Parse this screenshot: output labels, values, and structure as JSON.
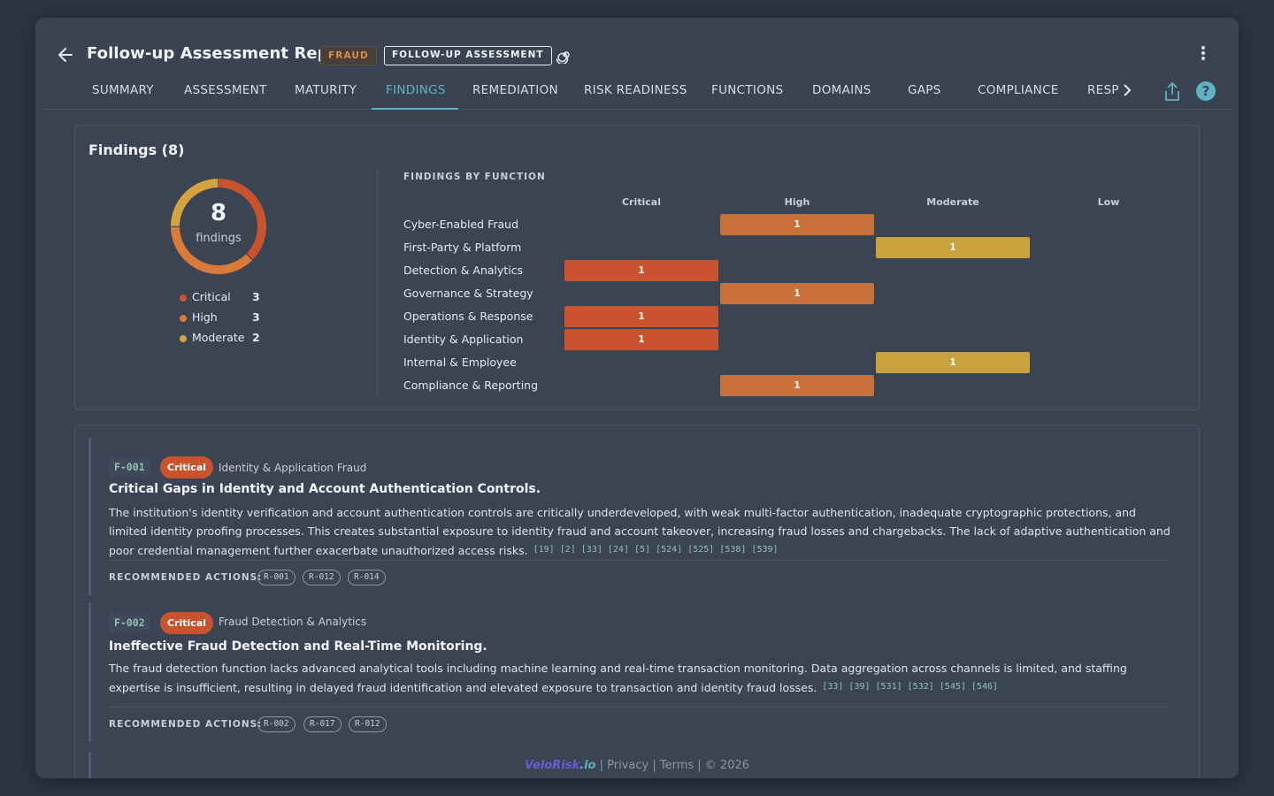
{
  "header": {
    "title": "Follow-up Assessment Report",
    "badge_fraud": "FRAUD",
    "badge_type": "FOLLOW-UP ASSESSMENT"
  },
  "tabs": [
    {
      "label": "SUMMARY"
    },
    {
      "label": "ASSESSMENT"
    },
    {
      "label": "MATURITY"
    },
    {
      "label": "FINDINGS",
      "active": true
    },
    {
      "label": "REMEDIATION"
    },
    {
      "label": "RISK READINESS"
    },
    {
      "label": "FUNCTIONS"
    },
    {
      "label": "DOMAINS"
    },
    {
      "label": "GAPS"
    },
    {
      "label": "COMPLIANCE"
    },
    {
      "label": "RESP"
    }
  ],
  "icons": {
    "back": "arrow-left-icon",
    "spiral": "spiral-icon",
    "more": "kebab-menu-icon",
    "next": "chevron-right-icon",
    "share": "share-icon",
    "help": "help-icon"
  },
  "summary": {
    "title": "Findings (8)",
    "total": "8",
    "total_label": "findings",
    "legend": [
      {
        "label": "Critical",
        "count": "3",
        "color": "#c9532f"
      },
      {
        "label": "High",
        "count": "3",
        "color": "#d77a3a"
      },
      {
        "label": "Moderate",
        "count": "2",
        "color": "#d4a23f"
      }
    ]
  },
  "chart_data": {
    "type": "heatmap",
    "title": "FINDINGS BY FUNCTION",
    "columns": [
      "Critical",
      "High",
      "Moderate",
      "Low"
    ],
    "rows": [
      {
        "label": "Cyber-Enabled Fraud",
        "severity": "High",
        "count": "1"
      },
      {
        "label": "First-Party & Platform",
        "severity": "Moderate",
        "count": "1"
      },
      {
        "label": "Detection & Analytics",
        "severity": "Critical",
        "count": "1"
      },
      {
        "label": "Governance & Strategy",
        "severity": "High",
        "count": "1"
      },
      {
        "label": "Operations & Response",
        "severity": "Critical",
        "count": "1"
      },
      {
        "label": "Identity & Application",
        "severity": "Critical",
        "count": "1"
      },
      {
        "label": "Internal & Employee",
        "severity": "Moderate",
        "count": "1"
      },
      {
        "label": "Compliance & Reporting",
        "severity": "High",
        "count": "1"
      }
    ],
    "colors": {
      "Critical": "#c9532f",
      "High": "#c97038",
      "Moderate": "#c9a13d",
      "Low": "#6b9a7a"
    },
    "donut": [
      {
        "label": "Critical",
        "value": 3,
        "color": "#c9532f"
      },
      {
        "label": "High",
        "value": 3,
        "color": "#d77a3a"
      },
      {
        "label": "Moderate",
        "value": 2,
        "color": "#d4a23f"
      }
    ]
  },
  "findings": [
    {
      "id": "F-001",
      "severity": "Critical",
      "domain": "Identity & Application Fraud",
      "title": "Critical Gaps in Identity and Account Authentication Controls.",
      "body": "The institution's identity verification and account authentication controls are critically underdeveloped, with weak multi-factor authentication, inadequate cryptographic protections, and limited identity proofing processes. This creates substantial exposure to identity fraud and account takeover, increasing fraud losses and chargebacks. The lack of adaptive authentication and poor credential management further exacerbate unauthorized access risks.",
      "citations": "[19] [2] [33] [24] [5] [524] [525] [538] [539]",
      "actions_label": "RECOMMENDED ACTIONS:",
      "actions": [
        "R-001",
        "R-012",
        "R-014"
      ]
    },
    {
      "id": "F-002",
      "severity": "Critical",
      "domain": "Fraud Detection & Analytics",
      "title": "Ineffective Fraud Detection and Real-Time Monitoring.",
      "body": "The fraud detection function lacks advanced analytical tools including machine learning and real-time transaction monitoring. Data aggregation across channels is limited, and staffing expertise is insufficient, resulting in delayed fraud identification and elevated exposure to transaction and identity fraud losses.",
      "citations": "[33] [39] [531] [532] [545] [546]",
      "actions_label": "RECOMMENDED ACTIONS:",
      "actions": [
        "R-002",
        "R-017",
        "R-012"
      ]
    }
  ],
  "footer": {
    "brand_main": "VeloRisk",
    "brand_tld": ".io",
    "sep1": " | ",
    "privacy": "Privacy",
    "sep2": " | ",
    "terms": "Terms",
    "copyright": " | © 2026"
  }
}
